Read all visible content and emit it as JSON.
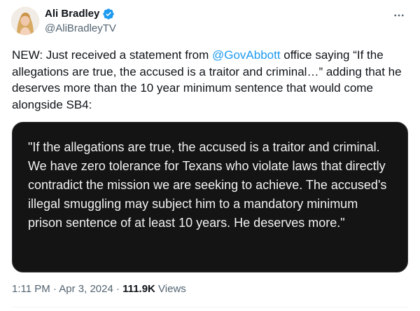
{
  "author": {
    "display_name": "Ali Bradley",
    "handle": "@AliBradleyTV",
    "verified": true,
    "avatar_icon": "user-avatar-photo"
  },
  "tweet": {
    "text_before_mention": "NEW: Just received a statement from ",
    "mention": "@GovAbbott",
    "text_after_mention": " office saying “If the allegations are true, the accused is a traitor and criminal…” adding that he deserves more than the 10 year minimum sentence that would come alongside SB4:"
  },
  "media": {
    "quote": "\"If the allegations are true, the accused is a traitor and criminal. We have zero tolerance for Texans who violate laws that directly contradict the mission we are seeking to achieve. The accused's illegal smuggling may subject him to a mandatory minimum prison sentence of at least 10 years. He deserves more.\""
  },
  "meta": {
    "time": "1:11 PM",
    "separator1": " · ",
    "date": "Apr 3, 2024",
    "separator2": " · ",
    "views_count": "111.9K",
    "views_label": " Views"
  },
  "icons": {
    "more": "more-horizontal-icon",
    "verified": "verified-badge-icon"
  },
  "colors": {
    "link": "#1d9bf0",
    "verified": "#1d9bf0",
    "secondary_text": "#536471",
    "card_background": "#141414"
  }
}
